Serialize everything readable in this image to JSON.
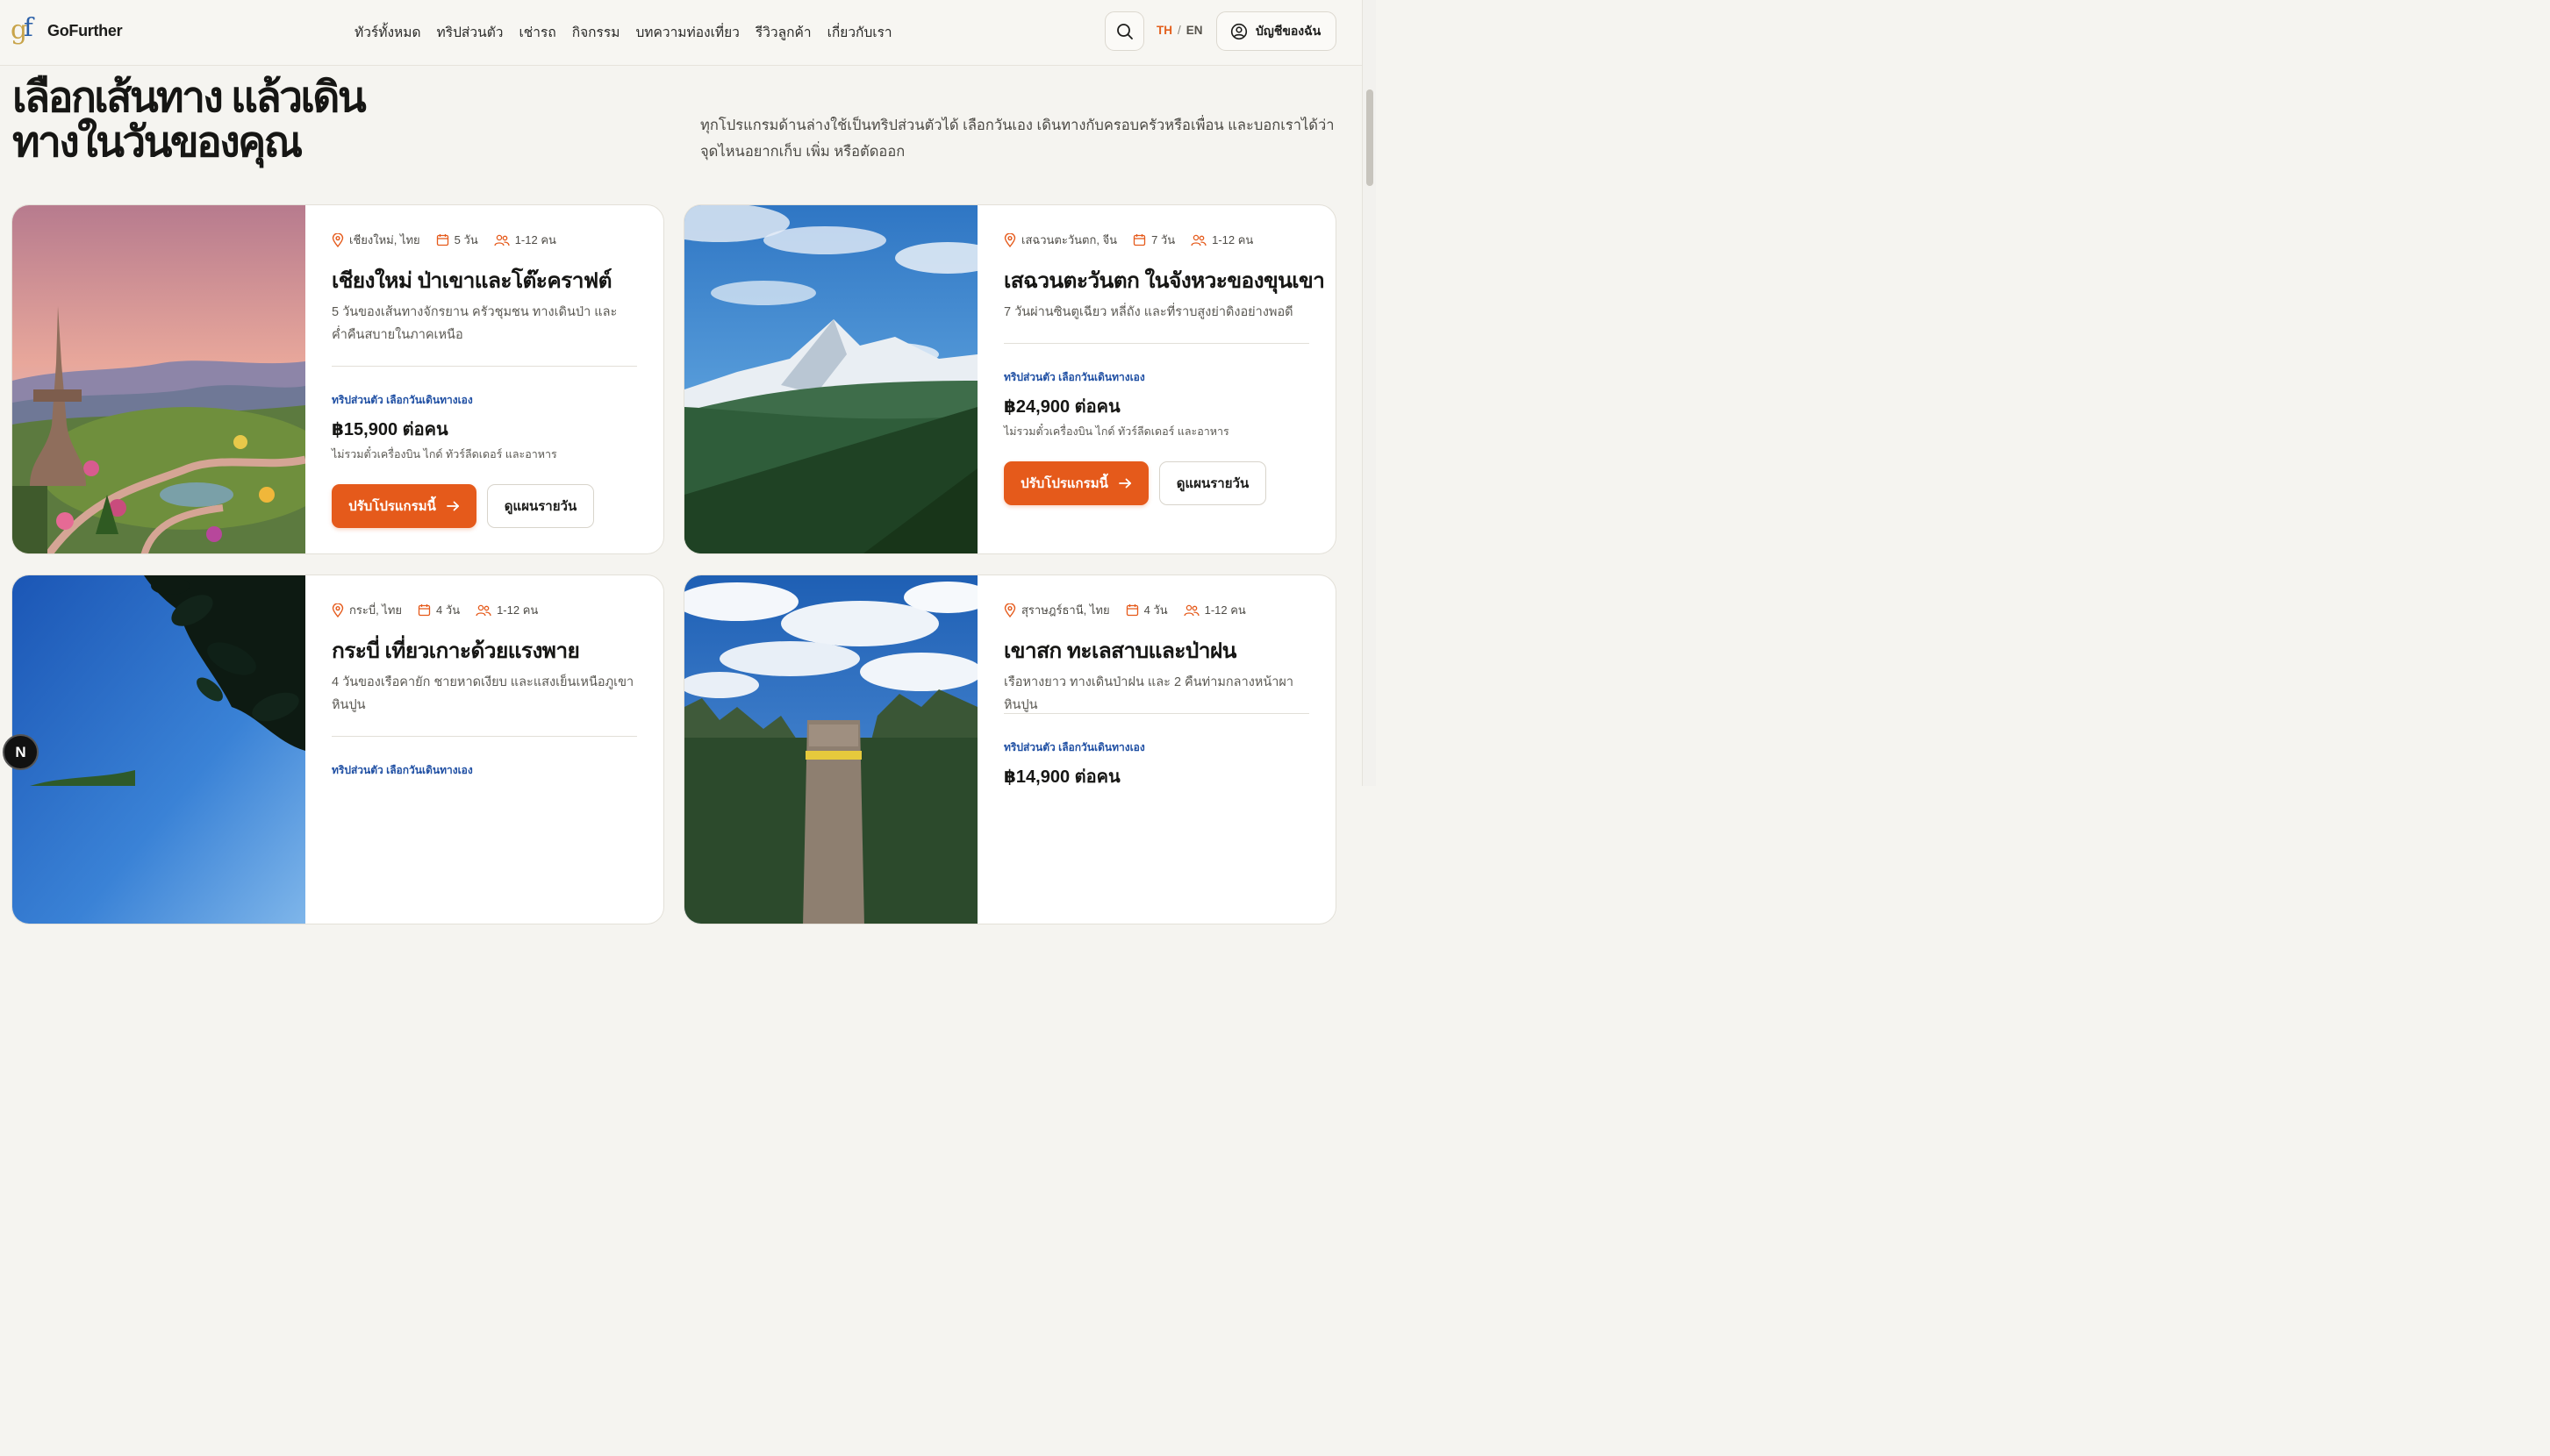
{
  "brand": {
    "name": "GoFurther",
    "mark": "gf"
  },
  "nav": [
    {
      "label": "ทัวร์ทั้งหมด"
    },
    {
      "label": "ทริปส่วนตัว"
    },
    {
      "label": "เช่ารถ"
    },
    {
      "label": "กิจกรรม"
    },
    {
      "label": "บทความท่องเที่ยว"
    },
    {
      "label": "รีวิวลูกค้า"
    },
    {
      "label": "เกี่ยวกับเรา"
    }
  ],
  "lang": {
    "active": "TH",
    "separator": "/",
    "other": "EN"
  },
  "account": {
    "label": "บัญชีของฉัน"
  },
  "hero": {
    "title": "เลือกเส้นทาง แล้วเดินทางในวันของคุณ",
    "description": "ทุกโปรแกรมด้านล่างใช้เป็นทริปส่วนตัวได้ เลือกวันเอง เดินทางกับครอบครัวหรือเพื่อน และบอกเราได้ว่าจุดไหนอยากเก็บ เพิ่ม หรือตัดออก"
  },
  "cards": [
    {
      "location": "เชียงใหม่, ไทย",
      "duration": "5 วัน",
      "group": "1-12 คน",
      "title": "เชียงใหม่ ป่าเขาและโต๊ะคราฟต์",
      "description": "5 วันของเส้นทางจักรยาน ครัวชุมชน ทางเดินป่า และค่ำคืนสบายในภาคเหนือ",
      "tag": "ทริปส่วนตัว เลือกวันเดินทางเอง",
      "price": "฿15,900 ต่อคน",
      "note": "ไม่รวมตั๋วเครื่องบิน ไกด์ ทัวร์ลีดเดอร์ และอาหาร",
      "primary_label": "ปรับโปรแกรมนี้",
      "secondary_label": "ดูแผนรายวัน",
      "image": "chiang-mai-temple-garden"
    },
    {
      "location": "เสฉวนตะวันตก, จีน",
      "duration": "7 วัน",
      "group": "1-12 คน",
      "title": "เสฉวนตะวันตก ในจังหวะของขุนเขา",
      "description": "7 วันผ่านซินตูเฉียว หลี่ถัง และที่ราบสูงย่าดิงอย่างพอดี",
      "tag": "ทริปส่วนตัว เลือกวันเดินทางเอง",
      "price": "฿24,900 ต่อคน",
      "note": "ไม่รวมตั๋วเครื่องบิน ไกด์ ทัวร์ลีดเดอร์ และอาหาร",
      "primary_label": "ปรับโปรแกรมนี้",
      "secondary_label": "ดูแผนรายวัน",
      "image": "snow-mountain"
    },
    {
      "location": "กระบี่, ไทย",
      "duration": "4 วัน",
      "group": "1-12 คน",
      "title": "กระบี่ เที่ยวเกาะด้วยแรงพาย",
      "description": "4 วันของเรือคายัก ชายหาดเงียบ และแสงเย็นเหนือภูเขาหินปูน",
      "tag": "ทริปส่วนตัว เลือกวันเดินทางเอง",
      "image": "krabi-sky-leaves"
    },
    {
      "location": "สุราษฎร์ธานี, ไทย",
      "duration": "4 วัน",
      "group": "1-12 คน",
      "title": "เขาสก ทะเลสาบและป่าฝน",
      "description": "เรือหางยาว ทางเดินป่าฝน และ 2 คืนท่ามกลางหน้าผาหินปูน",
      "tag": "ทริปส่วนตัว เลือกวันเดินทางเอง",
      "price": "฿14,900 ต่อคน",
      "image": "khao-sok-longtail-boat"
    }
  ],
  "dev_badge": "N",
  "colors": {
    "accent": "#e55a1b",
    "tag_blue": "#1f4fa3",
    "background": "#f5f4f0"
  }
}
